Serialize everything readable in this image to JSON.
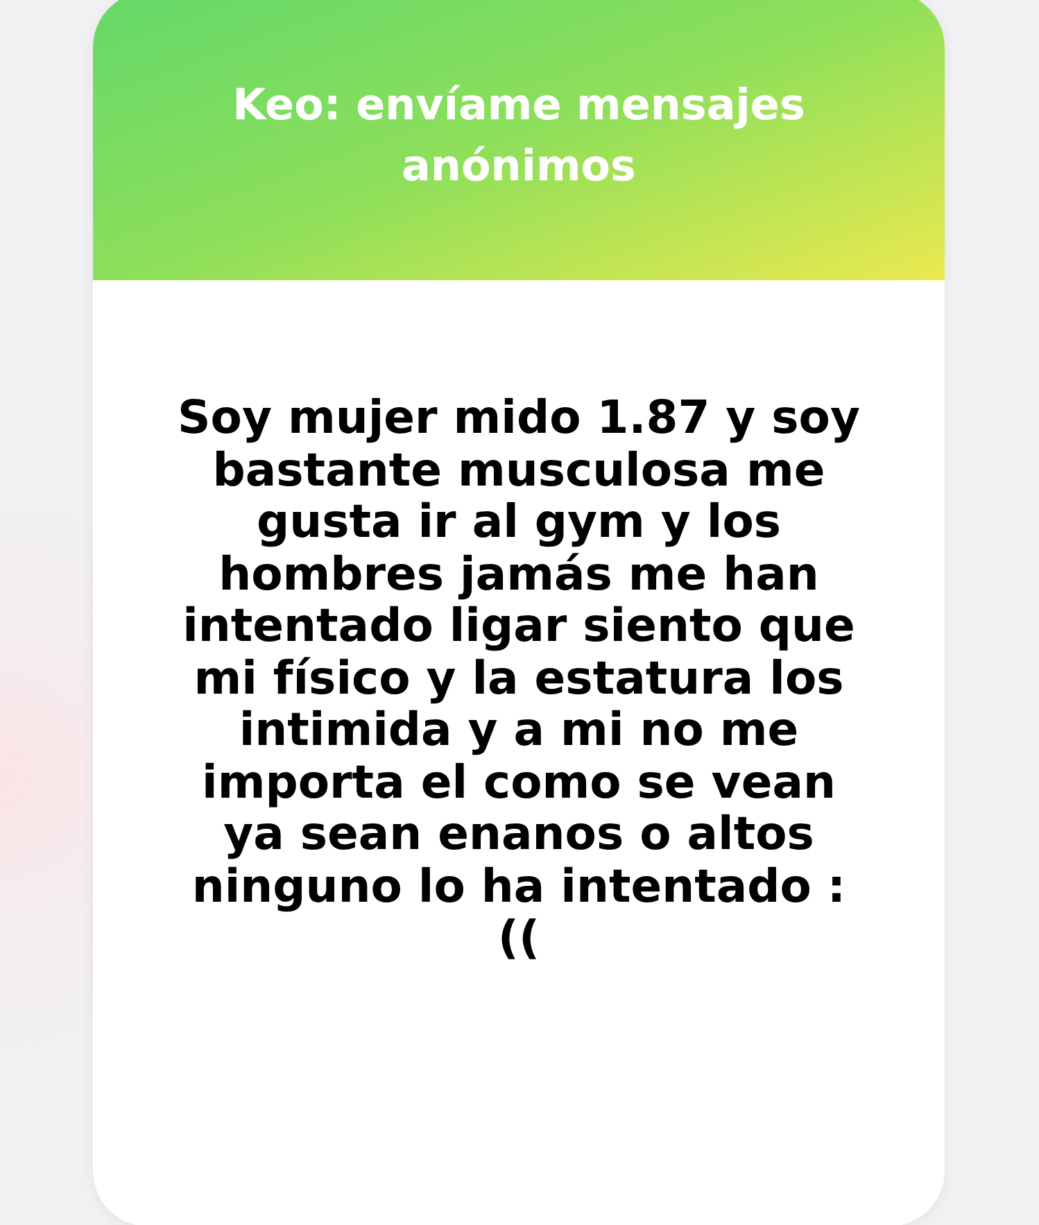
{
  "card": {
    "title": "Keo: envíame mensajes anónimos",
    "message": "Soy mujer mido 1.87 y soy bastante musculosa me gusta ir al gym y los hombres jamás me han intentado ligar siento que mi físico y la estatura los intimida y a mi no me importa el como se vean ya sean enanos o altos ninguno lo ha intentado :(("
  }
}
